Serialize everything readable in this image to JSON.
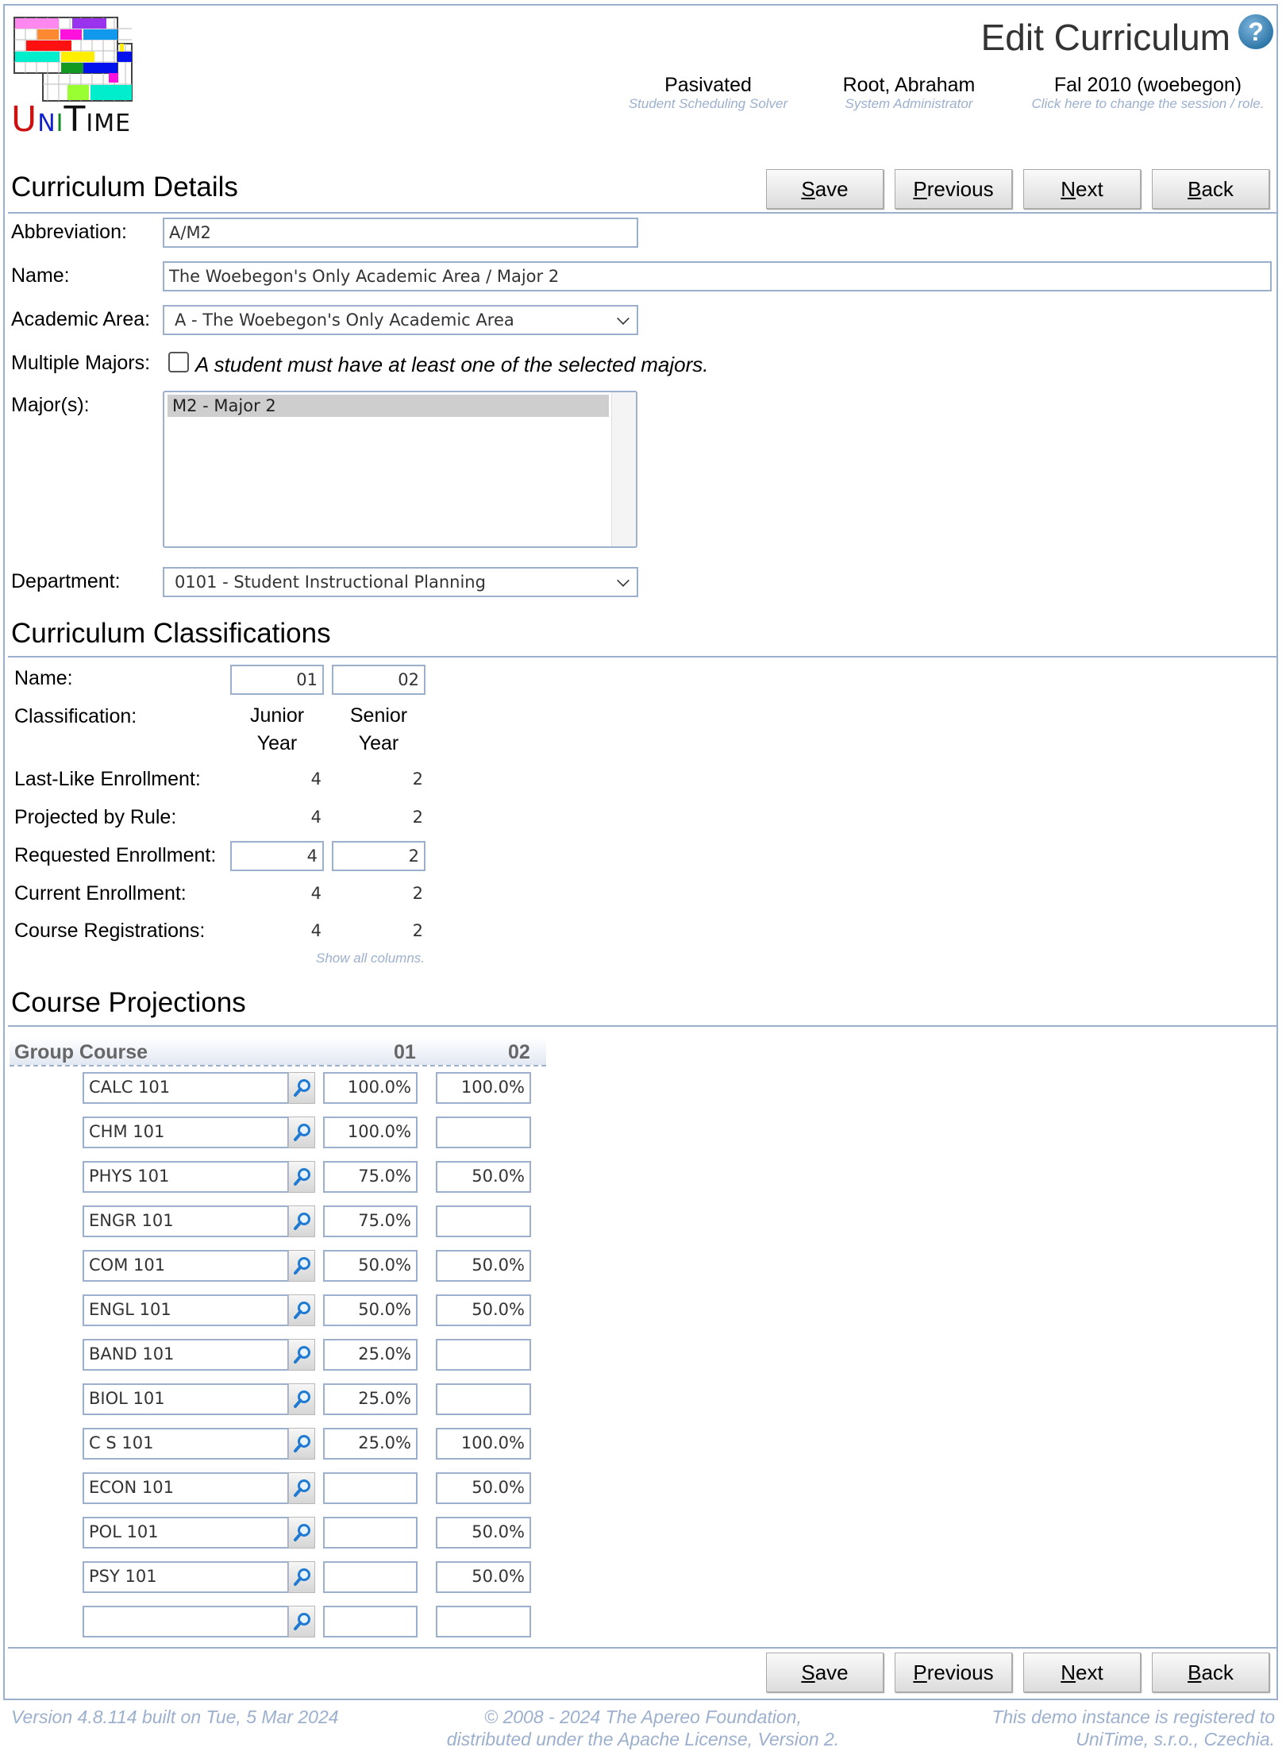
{
  "header": {
    "title": "Edit Curriculum",
    "help_icon": "help-icon",
    "solver": {
      "main": "Pasivated",
      "sub": "Student Scheduling Solver"
    },
    "user": {
      "main": "Root, Abraham",
      "sub": "System Administrator"
    },
    "session": {
      "main": "Fal 2010 (woebegon)",
      "sub": "Click here to change the session / role."
    },
    "logo_text": "UniTime"
  },
  "buttons": {
    "save": {
      "key": "S",
      "rest": "ave"
    },
    "previous": {
      "key": "P",
      "rest": "revious"
    },
    "next": {
      "key": "N",
      "rest": "ext"
    },
    "back": {
      "key": "B",
      "rest": "ack"
    }
  },
  "details": {
    "section_title": "Curriculum Details",
    "abbreviation_label": "Abbreviation:",
    "abbreviation_value": "A/M2",
    "name_label": "Name:",
    "name_value": "The Woebegon's Only Academic Area / Major 2",
    "academic_area_label": "Academic Area:",
    "academic_area_value": "A - The Woebegon's Only Academic Area",
    "multiple_majors_label": "Multiple Majors:",
    "multiple_majors_checked": false,
    "multiple_majors_note": "A student must have at least one of the selected majors.",
    "majors_label": "Major(s):",
    "majors_options": [
      "M2 - Major 2"
    ],
    "majors_selected": "M2 - Major 2",
    "department_label": "Department:",
    "department_value": "0101 - Student Instructional Planning"
  },
  "classifications": {
    "section_title": "Curriculum Classifications",
    "rows": {
      "name": "Name:",
      "classification": "Classification:",
      "last_like": "Last-Like Enrollment:",
      "projected": "Projected by Rule:",
      "requested": "Requested Enrollment:",
      "current": "Current Enrollment:",
      "registrations": "Course Registrations:"
    },
    "columns": [
      {
        "name": "01",
        "classification_line1": "Junior",
        "classification_line2": "Year",
        "last_like": "4",
        "projected": "4",
        "requested": "4",
        "current": "4",
        "registrations": "4"
      },
      {
        "name": "02",
        "classification_line1": "Senior",
        "classification_line2": "Year",
        "last_like": "2",
        "projected": "2",
        "requested": "2",
        "current": "2",
        "registrations": "2"
      }
    ],
    "show_all_link": "Show all columns."
  },
  "projections": {
    "section_title": "Course Projections",
    "header": {
      "group_course": "Group Course",
      "col1": "01",
      "col2": "02"
    },
    "rows": [
      {
        "course": "CALC 101",
        "c01": "100.0%",
        "c02": "100.0%"
      },
      {
        "course": "CHM 101",
        "c01": "100.0%",
        "c02": ""
      },
      {
        "course": "PHYS 101",
        "c01": "75.0%",
        "c02": "50.0%"
      },
      {
        "course": "ENGR 101",
        "c01": "75.0%",
        "c02": ""
      },
      {
        "course": "COM 101",
        "c01": "50.0%",
        "c02": "50.0%"
      },
      {
        "course": "ENGL 101",
        "c01": "50.0%",
        "c02": "50.0%"
      },
      {
        "course": "BAND 101",
        "c01": "25.0%",
        "c02": ""
      },
      {
        "course": "BIOL 101",
        "c01": "25.0%",
        "c02": ""
      },
      {
        "course": "C S 101",
        "c01": "25.0%",
        "c02": "100.0%"
      },
      {
        "course": "ECON 101",
        "c01": "",
        "c02": "50.0%"
      },
      {
        "course": "POL 101",
        "c01": "",
        "c02": "50.0%"
      },
      {
        "course": "PSY 101",
        "c01": "",
        "c02": "50.0%"
      },
      {
        "course": "",
        "c01": "",
        "c02": ""
      }
    ]
  },
  "footer": {
    "version": "Version 4.8.114 built on Tue, 5 Mar 2024",
    "copyright_line1": "© 2008 - 2024 The Apereo Foundation,",
    "copyright_line2": "distributed under the Apache License, Version 2.",
    "registered_line1": "This demo instance is registered to",
    "registered_line2": "UniTime, s.r.o., Czechia."
  },
  "colors": {
    "border": "#9cb0ce",
    "link": "#9cb0ce",
    "accent_blue": "#2f78aa"
  }
}
